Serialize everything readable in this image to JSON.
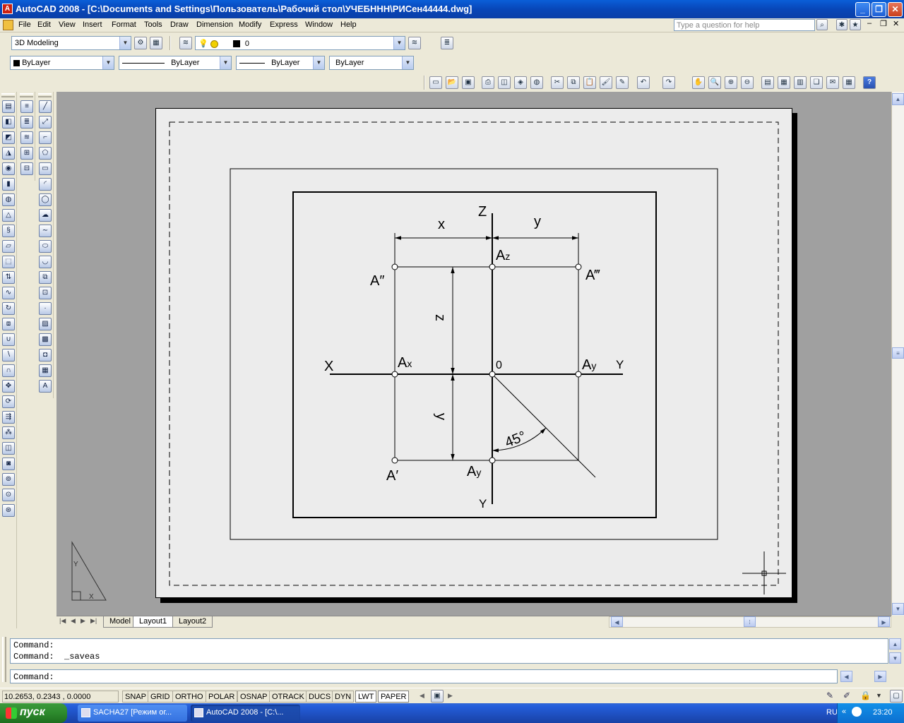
{
  "window": {
    "title": "AutoCAD 2008 - [C:\\Documents and Settings\\Пользователь\\Рабочий стол\\УЧЕБННН\\РИСен44444.dwg]"
  },
  "menu": [
    "File",
    "Edit",
    "View",
    "Insert",
    "Format",
    "Tools",
    "Draw",
    "Dimension",
    "Modify",
    "Express",
    "Window",
    "Help"
  ],
  "help": {
    "placeholder": "Type a question for help"
  },
  "workspace": {
    "value": "3D Modeling"
  },
  "layer": {
    "value": "0"
  },
  "properties": {
    "color": "ByLayer",
    "linetype": "ByLayer",
    "lineweight": "ByLayer",
    "plotstyle": "ByLayer"
  },
  "drawing": {
    "labels": {
      "z_axis": "Z",
      "x_dim": "x",
      "y_dim_top": "y",
      "az": "A",
      "az_sub": "z",
      "a2": "A″",
      "a3": "A‴",
      "z_dim": "z",
      "x_axis": "X",
      "ax": "A",
      "ax_sub": "x",
      "origin": "0",
      "ay_right": "A",
      "ay_right_sub": "y",
      "y_axis_right": "Y",
      "y_dim_left": "y",
      "angle": "45°",
      "a1": "A′",
      "ay_bottom": "A",
      "ay_bottom_sub": "y",
      "y_axis_bottom": "Y"
    },
    "ucs": {
      "x": "X",
      "y": "Y"
    }
  },
  "tabs": [
    "Model",
    "Layout1",
    "Layout2"
  ],
  "command": {
    "history1": "Command:",
    "history2": "Command:  _saveas",
    "prompt": "Command:"
  },
  "status": {
    "coords": "10.2653, 0.2343 , 0.0000",
    "toggles": [
      "SNAP",
      "GRID",
      "ORTHO",
      "POLAR",
      "OSNAP",
      "OTRACK",
      "DUCS",
      "DYN",
      "LWT",
      "PAPER"
    ]
  },
  "taskbar": {
    "start": "пуск",
    "tasks": [
      "SACHA27 [Режим ог...",
      "AutoCAD 2008 - [C:\\..."
    ],
    "lang": "RU",
    "clock": "23:20"
  },
  "colors": {
    "accent": "#0a5fd8",
    "canvas": "#a0a0a0",
    "paper": "#ececec"
  }
}
